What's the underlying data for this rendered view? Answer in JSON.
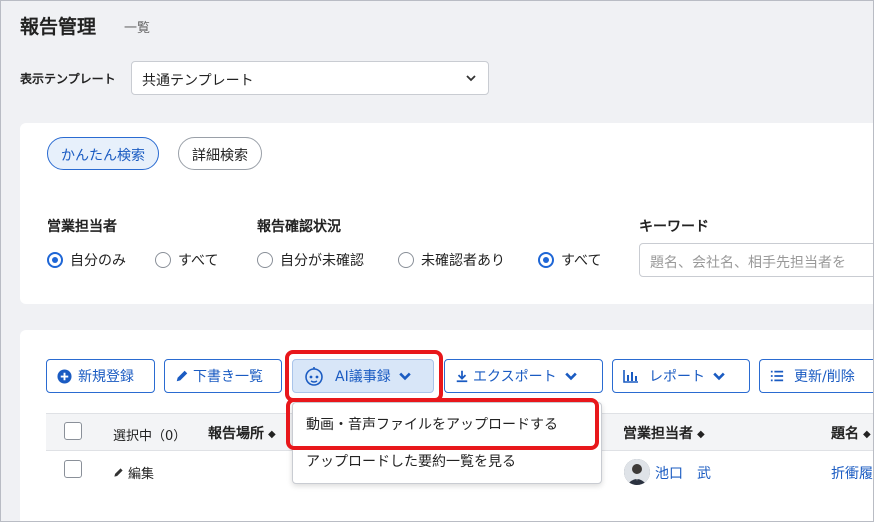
{
  "header": {
    "title": "報告管理",
    "subtitle": "一覧"
  },
  "template": {
    "label": "表示テンプレート",
    "selected": "共通テンプレート"
  },
  "search": {
    "tabs": [
      {
        "label": "かんたん検索",
        "active": true
      },
      {
        "label": "詳細検索",
        "active": false
      }
    ],
    "sales_rep": {
      "label": "営業担当者",
      "options": [
        {
          "label": "自分のみ",
          "selected": true
        },
        {
          "label": "すべて",
          "selected": false
        }
      ]
    },
    "confirm_status": {
      "label": "報告確認状況",
      "options": [
        {
          "label": "自分が未確認",
          "selected": false
        },
        {
          "label": "未確認者あり",
          "selected": false
        },
        {
          "label": "すべて",
          "selected": true
        }
      ]
    },
    "keyword": {
      "label": "キーワード",
      "placeholder": "題名、会社名、相手先担当者を"
    }
  },
  "toolbar": {
    "new": "新規登録",
    "drafts": "下書き一覧",
    "ai": "AI議事録",
    "export": "エクスポート",
    "report": "レポート",
    "update": "更新/削除"
  },
  "ai_menu": {
    "items": [
      "動画・音声ファイルをアップロードする",
      "アップロードした要約一覧を見る"
    ]
  },
  "table": {
    "selected_label": "選択中（0）",
    "columns": {
      "place": "報告場所",
      "sales_rep": "営業担当者",
      "title": "題名"
    },
    "rows": [
      {
        "action": "編集",
        "sales_rep": "池口　武",
        "title": "折衝履"
      }
    ]
  },
  "colors": {
    "accent": "#1a5bc2",
    "highlight": "#e8171b"
  }
}
